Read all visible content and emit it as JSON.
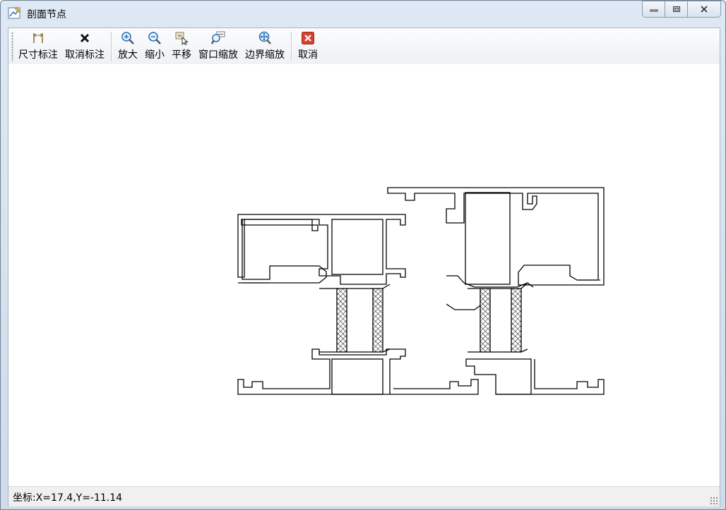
{
  "window": {
    "title": "剖面节点",
    "title_icon": "drawing-icon",
    "caption_buttons": {
      "minimize_icon": "minimize-icon",
      "maximize_icon": "restore-icon",
      "close_icon": "close-icon"
    }
  },
  "toolbar": {
    "items": [
      {
        "label": "尺寸标注",
        "icon": "dimension-icon"
      },
      {
        "label": "取消标注",
        "icon": "cancel-dimension-icon"
      },
      {
        "label": "放大",
        "icon": "zoom-in-icon"
      },
      {
        "label": "缩小",
        "icon": "zoom-out-icon"
      },
      {
        "label": "平移",
        "icon": "pan-icon"
      },
      {
        "label": "窗口缩放",
        "icon": "window-zoom-icon"
      },
      {
        "label": "边界缩放",
        "icon": "extents-zoom-icon"
      },
      {
        "label": "取消",
        "icon": "cancel-icon"
      }
    ]
  },
  "drawing": {
    "content": "aluminum window frame cross-section profile",
    "line_color": "#000000"
  },
  "status": {
    "coordinates": "坐标:X=17.4,Y=-11.14"
  },
  "colors": {
    "window_frame": "#cfdbe9",
    "toolbar_bg": "#eef1f5",
    "status_bg": "#f0f0f0",
    "cancel_red": "#d9412e"
  }
}
